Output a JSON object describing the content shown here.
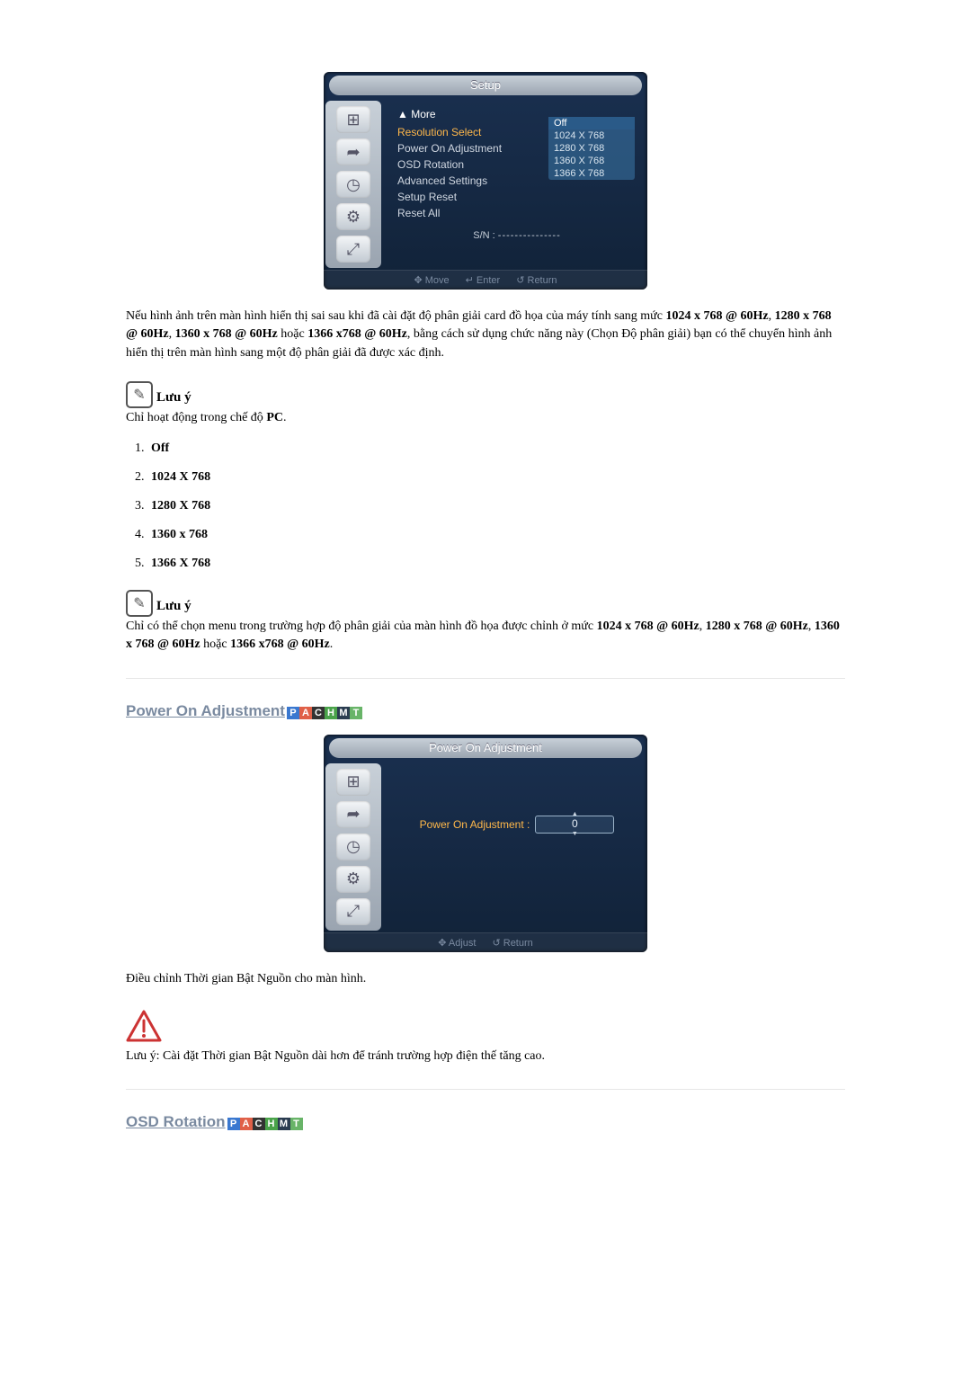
{
  "osd_setup": {
    "title": "Setup",
    "sidebar_icons": [
      "display-icon",
      "signal-icon",
      "clock-icon",
      "gear-icon",
      "size-icon"
    ],
    "more": "▲ More",
    "items": [
      "Resolution Select",
      "Power On Adjustment",
      "OSD Rotation",
      "Advanced Settings",
      "Setup Reset",
      "Reset All"
    ],
    "dropdown": [
      "Off",
      "1024 X 768",
      "1280 X 768",
      "1360 X 768",
      "1366 X 768"
    ],
    "sn_label": "S/N :",
    "footer": {
      "move": "Move",
      "enter": "Enter",
      "return": "Return"
    }
  },
  "para1_pre": "Nếu hình ảnh trên màn hình hiển thị sai sau khi đã cài đặt độ phân giải card đồ họa của máy tính sang mức ",
  "b1": "1024 x 768 @ 60Hz",
  "c1": ", ",
  "b2": "1280 x 768 @ 60Hz",
  "c2": ", ",
  "b3": "1360 x 768 @ 60Hz",
  "c3": " hoặc ",
  "b4": "1366 x768 @ 60Hz",
  "para1_post": ", bằng cách sử dụng chức năng này (Chọn Độ phân giải) bạn có thể chuyển hình ảnh hiển thị trên màn hình sang một độ phân giải đã được xác định.",
  "note_label": "Lưu ý",
  "note1_pre": "Chỉ hoạt động trong chế độ ",
  "note1_b": "PC",
  "note1_post": ".",
  "options": [
    "Off",
    "1024 X 768",
    "1280 X 768",
    "1360 x 768",
    "1366 X 768"
  ],
  "note2_pre": "Chỉ có thể chọn menu trong trường hợp độ phân giải của màn hình đồ họa được chỉnh ở mức ",
  "n2b1": "1024 x 768 @ 60Hz",
  "n2c1": ", ",
  "n2b2": "1280 x 768 @ 60Hz",
  "n2c2": ", ",
  "n2b3": "1360 x 768 @ 60Hz",
  "n2c3": " hoặc ",
  "n2b4": "1366 x768 @ 60Hz",
  "n2post": ".",
  "poa_title": "Power On Adjustment",
  "osd_poa": {
    "title": "Power On Adjustment",
    "label": "Power On Adjustment :",
    "value": "0",
    "footer": {
      "adjust": "Adjust",
      "return": "Return"
    }
  },
  "poa_desc": "Điều chỉnh Thời gian Bật Nguồn cho màn hình.",
  "poa_warn": "Lưu ý: Cài đặt Thời gian Bật Nguồn dài hơn để tránh trường hợp điện thế tăng cao.",
  "osdrot_title": "OSD Rotation",
  "badges": [
    "P",
    "A",
    "C",
    "H",
    "M",
    "T"
  ]
}
